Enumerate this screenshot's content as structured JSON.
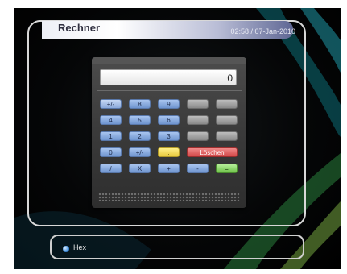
{
  "header": {
    "title": "Rechner",
    "datetime": "02:58 / 07-Jan-2010"
  },
  "display": {
    "value": "0"
  },
  "keypad": {
    "rows": [
      [
        {
          "label": "+/-",
          "color": "blue",
          "selected": true
        },
        {
          "label": "8",
          "color": "blue"
        },
        {
          "label": "9",
          "color": "blue"
        },
        {
          "label": "",
          "color": "gray"
        },
        {
          "label": "",
          "color": "gray"
        }
      ],
      [
        {
          "label": "4",
          "color": "blue"
        },
        {
          "label": "5",
          "color": "blue"
        },
        {
          "label": "6",
          "color": "blue"
        },
        {
          "label": "",
          "color": "gray"
        },
        {
          "label": "",
          "color": "gray"
        }
      ],
      [
        {
          "label": "1",
          "color": "blue"
        },
        {
          "label": "2",
          "color": "blue"
        },
        {
          "label": "3",
          "color": "blue"
        },
        {
          "label": "",
          "color": "gray"
        },
        {
          "label": "",
          "color": "gray"
        }
      ],
      [
        {
          "label": "0",
          "color": "blue"
        },
        {
          "label": "+/-",
          "color": "blue"
        },
        {
          "label": ".",
          "color": "yellow"
        },
        {
          "label": "Löschen",
          "color": "red"
        }
      ],
      [
        {
          "label": "/",
          "color": "blue"
        },
        {
          "label": "X",
          "color": "blue"
        },
        {
          "label": "+",
          "color": "blue"
        },
        {
          "label": "-",
          "color": "blue"
        },
        {
          "label": "=",
          "color": "green"
        }
      ]
    ]
  },
  "footer": {
    "hint_label": "Hex",
    "hint_icon": "blue-dot-icon"
  },
  "colors": {
    "key_blue": "#7fa3d8",
    "key_gray": "#9a9a9a",
    "key_yellow": "#efd656",
    "key_red": "#e05a5a",
    "key_green": "#86d260"
  }
}
